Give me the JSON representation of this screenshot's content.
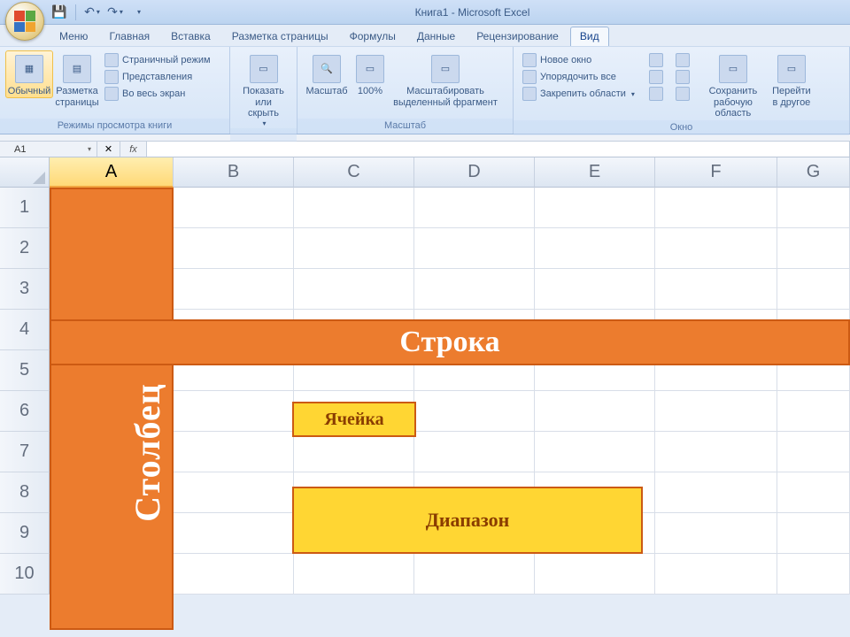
{
  "title": "Книга1 - Microsoft Excel",
  "tabs": [
    "Меню",
    "Главная",
    "Вставка",
    "Разметка страницы",
    "Формулы",
    "Данные",
    "Рецензирование",
    "Вид"
  ],
  "active_tab": "Вид",
  "ribbon": {
    "views": {
      "label": "Режимы просмотра книги",
      "normal": "Обычный",
      "layout": "Разметка страницы",
      "pagebreak": "Страничный режим",
      "custom": "Представления",
      "fullscreen": "Во весь экран"
    },
    "showhide": {
      "btn": "Показать или скрыть"
    },
    "zoom": {
      "label": "Масштаб",
      "zoom": "Масштаб",
      "hundred": "100%",
      "selection": "Масштабировать выделенный фрагмент"
    },
    "window": {
      "label": "Окно",
      "newwin": "Новое окно",
      "arrange": "Упорядочить все",
      "freeze": "Закрепить области",
      "save_ws": "Сохранить рабочую область",
      "switch": "Перейти в другое"
    }
  },
  "namebox": "A1",
  "columns": [
    "A",
    "B",
    "C",
    "D",
    "E",
    "F",
    "G"
  ],
  "rows": [
    "1",
    "2",
    "3",
    "4",
    "5",
    "6",
    "7",
    "8",
    "9",
    "10"
  ],
  "labels": {
    "row": "Строка",
    "col": "Столбец",
    "cell": "Ячейка",
    "range": "Диапазон"
  }
}
